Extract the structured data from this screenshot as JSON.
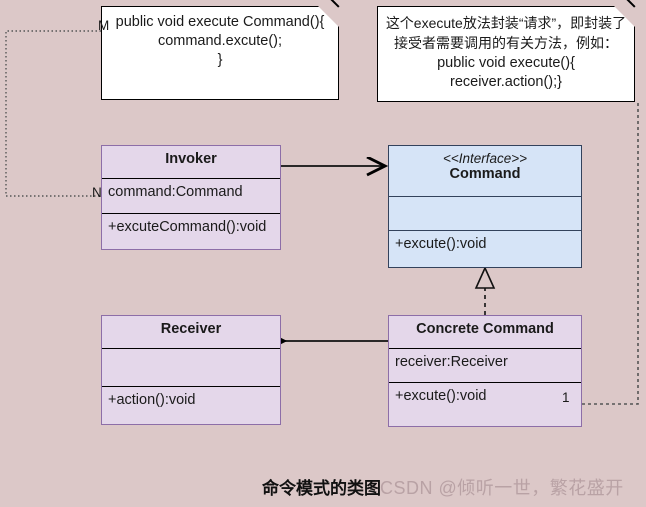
{
  "diagram": {
    "caption": "命令模式的类图",
    "watermark": "CSDN @倾听一世，繁花盛开",
    "background_color": "#dcc8c8",
    "class_fill_color": "#e4d7ea",
    "class_border_color": "#8d6ea8",
    "interface_fill_color": "#d6e4f7",
    "interface_border_color": "#33425c"
  },
  "notes": {
    "left": {
      "line1": "public void execute Command(){",
      "line2": "command.excute();",
      "line3": "}",
      "anchor_label": "M"
    },
    "right": {
      "line1": "这个execute放法封装“请求”，即封装了接受者需要调用的有关方法，例如：",
      "line2": "public void execute(){",
      "line3": "receiver.action();}"
    }
  },
  "classes": {
    "invoker": {
      "name": "Invoker",
      "attributes": [
        "command:Command"
      ],
      "operations": [
        "+excuteCommand():void"
      ],
      "anchor_label": "N"
    },
    "command": {
      "stereotype": "<<Interface>>",
      "name": "Command",
      "attributes": [
        ""
      ],
      "operations": [
        "+excute():void"
      ]
    },
    "receiver": {
      "name": "Receiver",
      "attributes": [
        ""
      ],
      "operations": [
        "+action():void"
      ]
    },
    "concrete_command": {
      "name": "Concrete Command",
      "attributes": [
        "receiver:Receiver"
      ],
      "operations": [
        "+excute():void"
      ],
      "multiplicity": "1"
    }
  },
  "relations": {
    "invoker_to_command": "association",
    "concrete_to_receiver": "association",
    "concrete_to_command": "realization"
  }
}
